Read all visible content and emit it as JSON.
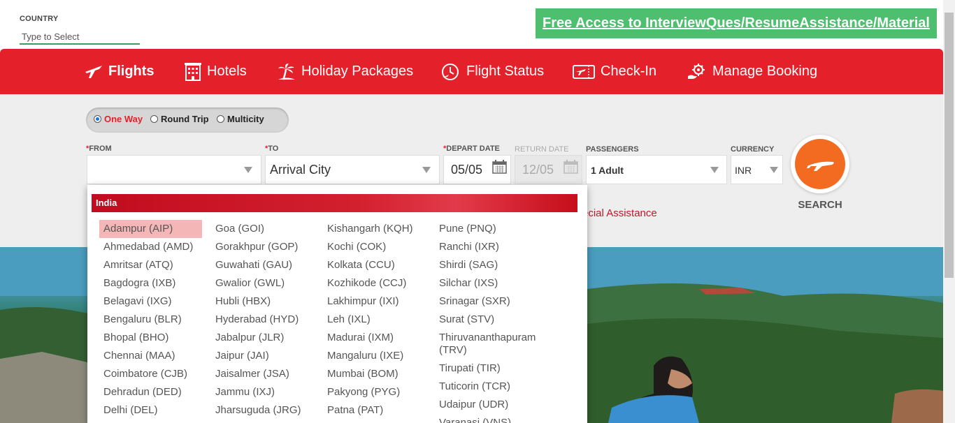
{
  "header": {
    "country_label": "COUNTRY",
    "country_placeholder": "Type to Select",
    "promo_link": "Free Access to InterviewQues/ResumeAssistance/Material"
  },
  "nav": {
    "items": [
      {
        "label": "Flights",
        "icon": "plane-icon",
        "active": true
      },
      {
        "label": "Hotels",
        "icon": "hotel-building-icon"
      },
      {
        "label": "Holiday Packages",
        "icon": "palm-tree-icon"
      },
      {
        "label": "Flight Status",
        "icon": "clock-plane-icon"
      },
      {
        "label": "Check-In",
        "icon": "boarding-pass-icon"
      },
      {
        "label": "Manage Booking",
        "icon": "gear-hand-icon"
      }
    ]
  },
  "trip_type": {
    "options": [
      "One Way",
      "Round Trip",
      "Multicity"
    ],
    "selected": "One Way"
  },
  "form": {
    "from_label": "FROM",
    "to_label": "TO",
    "to_value": "Arrival City",
    "depart_label": "DEPART DATE",
    "depart_value": "05/05",
    "return_label": "RETURN DATE",
    "return_value": "12/05",
    "passengers_label": "PASSENGERS",
    "passengers_value": "1 Adult",
    "currency_label": "CURRENCY",
    "currency_value": "INR",
    "search_label": "SEARCH",
    "special_assistance": "ecial Assistance"
  },
  "dropdown": {
    "country": "India",
    "selected": "Adampur (AIP)",
    "columns": [
      [
        "Adampur (AIP)",
        "Ahmedabad (AMD)",
        "Amritsar (ATQ)",
        "Bagdogra (IXB)",
        "Belagavi (IXG)",
        "Bengaluru (BLR)",
        "Bhopal (BHO)",
        "Chennai (MAA)",
        "Coimbatore (CJB)",
        "Dehradun (DED)",
        "Delhi (DEL)"
      ],
      [
        "Goa (GOI)",
        "Gorakhpur (GOP)",
        "Guwahati (GAU)",
        "Gwalior (GWL)",
        "Hubli (HBX)",
        "Hyderabad (HYD)",
        "Jabalpur (JLR)",
        "Jaipur (JAI)",
        "Jaisalmer (JSA)",
        "Jammu (IXJ)",
        "Jharsuguda (JRG)"
      ],
      [
        "Kishangarh (KQH)",
        "Kochi (COK)",
        "Kolkata (CCU)",
        "Kozhikode (CCJ)",
        "Lakhimpur (IXI)",
        "Leh (IXL)",
        "Madurai (IXM)",
        "Mangaluru (IXE)",
        "Mumbai (BOM)",
        "Pakyong (PYG)",
        "Patna (PAT)"
      ],
      [
        "Pune (PNQ)",
        "Ranchi (IXR)",
        "Shirdi (SAG)",
        "Silchar (IXS)",
        "Srinagar (SXR)",
        "Surat (STV)",
        "Thiruvananthapuram (TRV)",
        "Tirupati (TIR)",
        "Tuticorin (TCR)",
        "Udaipur (UDR)",
        "Varanasi (VNS)"
      ]
    ]
  },
  "colors": {
    "brand_red": "#e4202a",
    "promo_green": "#4dbf6f",
    "search_orange": "#f36b21",
    "selected_row": "#f4b6b6"
  }
}
